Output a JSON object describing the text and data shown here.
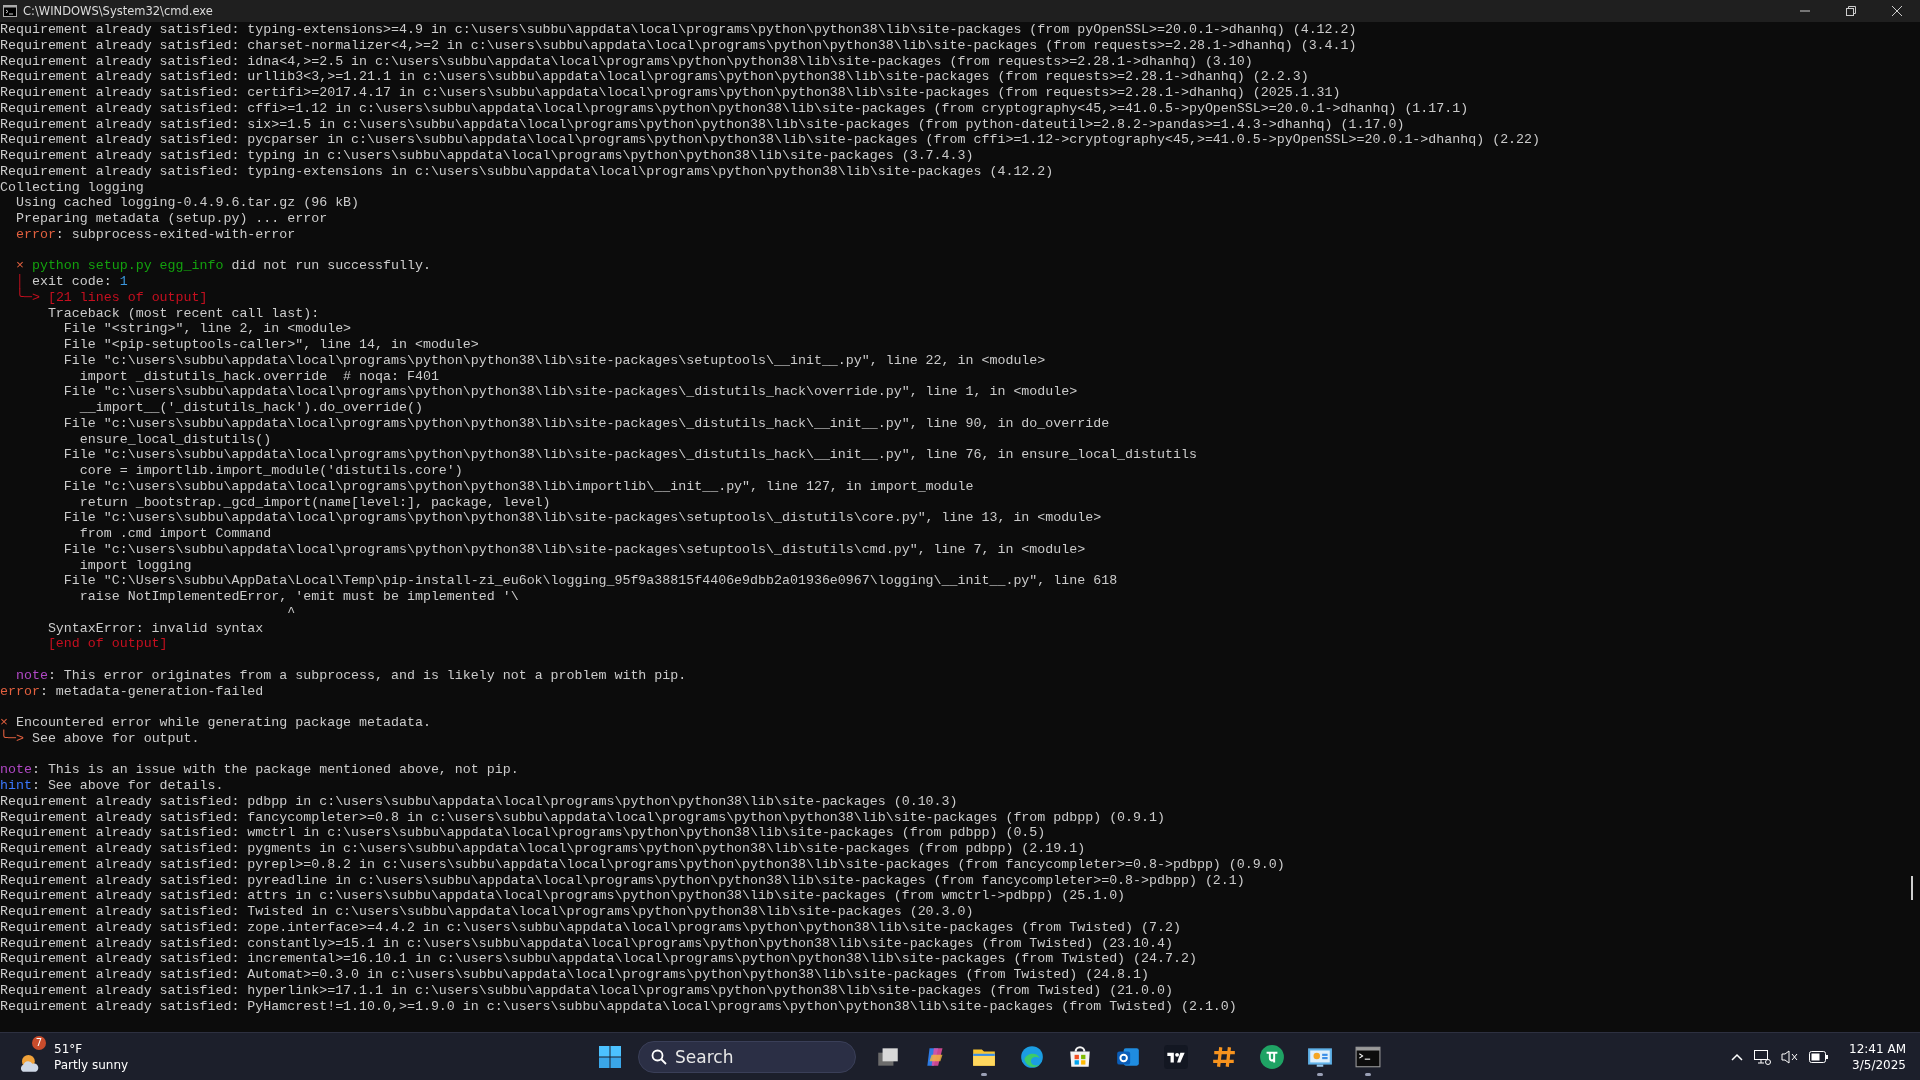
{
  "window": {
    "title": "C:\\WINDOWS\\System32\\cmd.exe"
  },
  "terminal": {
    "lines": [
      {
        "kind": "output",
        "spans": [
          {
            "text": "Requirement already satisfied: typing-extensions>=4.9 in c:\\users\\subbu\\appdata\\local\\programs\\python\\python38\\lib\\site-packages (from pyOpenSSL>=20.0.1->dhanhq) (4.12.2)",
            "kind": "plain"
          }
        ]
      },
      {
        "kind": "output",
        "spans": [
          {
            "text": "Requirement already satisfied: charset-normalizer<4,>=2 in c:\\users\\subbu\\appdata\\local\\programs\\python\\python38\\lib\\site-packages (from requests>=2.28.1->dhanhq) (3.4.1)",
            "kind": "plain"
          }
        ]
      },
      {
        "kind": "output",
        "spans": [
          {
            "text": "Requirement already satisfied: idna<4,>=2.5 in c:\\users\\subbu\\appdata\\local\\programs\\python\\python38\\lib\\site-packages (from requests>=2.28.1->dhanhq) (3.10)",
            "kind": "plain"
          }
        ]
      },
      {
        "kind": "output",
        "spans": [
          {
            "text": "Requirement already satisfied: urllib3<3,>=1.21.1 in c:\\users\\subbu\\appdata\\local\\programs\\python\\python38\\lib\\site-packages (from requests>=2.28.1->dhanhq) (2.2.3)",
            "kind": "plain"
          }
        ]
      },
      {
        "kind": "output",
        "spans": [
          {
            "text": "Requirement already satisfied: certifi>=2017.4.17 in c:\\users\\subbu\\appdata\\local\\programs\\python\\python38\\lib\\site-packages (from requests>=2.28.1->dhanhq) (2025.1.31)",
            "kind": "plain"
          }
        ]
      },
      {
        "kind": "output",
        "spans": [
          {
            "text": "Requirement already satisfied: cffi>=1.12 in c:\\users\\subbu\\appdata\\local\\programs\\python\\python38\\lib\\site-packages (from cryptography<45,>=41.0.5->pyOpenSSL>=20.0.1->dhanhq) (1.17.1)",
            "kind": "plain"
          }
        ]
      },
      {
        "kind": "output",
        "spans": [
          {
            "text": "Requirement already satisfied: six>=1.5 in c:\\users\\subbu\\appdata\\local\\programs\\python\\python38\\lib\\site-packages (from python-dateutil>=2.8.2->pandas>=1.4.3->dhanhq) (1.17.0)",
            "kind": "plain"
          }
        ]
      },
      {
        "kind": "output",
        "spans": [
          {
            "text": "Requirement already satisfied: pycparser in c:\\users\\subbu\\appdata\\local\\programs\\python\\python38\\lib\\site-packages (from cffi>=1.12->cryptography<45,>=41.0.5->pyOpenSSL>=20.0.1->dhanhq) (2.22)",
            "kind": "plain"
          }
        ]
      },
      {
        "kind": "output",
        "spans": [
          {
            "text": "Requirement already satisfied: typing in c:\\users\\subbu\\appdata\\local\\programs\\python\\python38\\lib\\site-packages (3.7.4.3)",
            "kind": "plain"
          }
        ]
      },
      {
        "kind": "output",
        "spans": [
          {
            "text": "Requirement already satisfied: typing-extensions in c:\\users\\subbu\\appdata\\local\\programs\\python\\python38\\lib\\site-packages (4.12.2)",
            "kind": "plain"
          }
        ]
      },
      {
        "kind": "output",
        "spans": [
          {
            "text": "Collecting logging",
            "kind": "plain"
          }
        ]
      },
      {
        "kind": "output",
        "spans": [
          {
            "text": "  Using cached logging-0.4.9.6.tar.gz (96 kB)",
            "kind": "plain"
          }
        ]
      },
      {
        "kind": "output",
        "spans": [
          {
            "text": "  Preparing metadata (setup.py) ... error",
            "kind": "plain"
          }
        ]
      },
      {
        "kind": "output",
        "spans": [
          {
            "text": "  error",
            "kind": "error"
          },
          {
            "text": ": subprocess-exited-with-error",
            "kind": "plain"
          }
        ]
      },
      {
        "kind": "blank"
      },
      {
        "kind": "output",
        "spans": [
          {
            "text": "  ×",
            "kind": "error"
          },
          {
            "text": " python setup.py egg_info",
            "kind": "green"
          },
          {
            "text": " did not run successfully.",
            "kind": "plain"
          }
        ]
      },
      {
        "kind": "output",
        "spans": [
          {
            "text": "  │",
            "kind": "red"
          },
          {
            "text": " exit code: ",
            "kind": "plain"
          },
          {
            "text": "1",
            "kind": "cyan"
          }
        ]
      },
      {
        "kind": "output",
        "spans": [
          {
            "text": "  ╰─> [21 lines of output]",
            "kind": "red"
          }
        ]
      },
      {
        "kind": "output",
        "spans": [
          {
            "text": "      Traceback (most recent call last):",
            "kind": "plain"
          }
        ]
      },
      {
        "kind": "output",
        "spans": [
          {
            "text": "        File \"<string>\", line 2, in <module>",
            "kind": "plain"
          }
        ]
      },
      {
        "kind": "output",
        "spans": [
          {
            "text": "        File \"<pip-setuptools-caller>\", line 14, in <module>",
            "kind": "plain"
          }
        ]
      },
      {
        "kind": "output",
        "spans": [
          {
            "text": "        File \"c:\\users\\subbu\\appdata\\local\\programs\\python\\python38\\lib\\site-packages\\setuptools\\__init__.py\", line 22, in <module>",
            "kind": "plain"
          }
        ]
      },
      {
        "kind": "output",
        "spans": [
          {
            "text": "          import _distutils_hack.override  # noqa: F401",
            "kind": "plain"
          }
        ]
      },
      {
        "kind": "output",
        "spans": [
          {
            "text": "        File \"c:\\users\\subbu\\appdata\\local\\programs\\python\\python38\\lib\\site-packages\\_distutils_hack\\override.py\", line 1, in <module>",
            "kind": "plain"
          }
        ]
      },
      {
        "kind": "output",
        "spans": [
          {
            "text": "          __import__('_distutils_hack').do_override()",
            "kind": "plain"
          }
        ]
      },
      {
        "kind": "output",
        "spans": [
          {
            "text": "        File \"c:\\users\\subbu\\appdata\\local\\programs\\python\\python38\\lib\\site-packages\\_distutils_hack\\__init__.py\", line 90, in do_override",
            "kind": "plain"
          }
        ]
      },
      {
        "kind": "output",
        "spans": [
          {
            "text": "          ensure_local_distutils()",
            "kind": "plain"
          }
        ]
      },
      {
        "kind": "output",
        "spans": [
          {
            "text": "        File \"c:\\users\\subbu\\appdata\\local\\programs\\python\\python38\\lib\\site-packages\\_distutils_hack\\__init__.py\", line 76, in ensure_local_distutils",
            "kind": "plain"
          }
        ]
      },
      {
        "kind": "output",
        "spans": [
          {
            "text": "          core = importlib.import_module('distutils.core')",
            "kind": "plain"
          }
        ]
      },
      {
        "kind": "output",
        "spans": [
          {
            "text": "        File \"c:\\users\\subbu\\appdata\\local\\programs\\python\\python38\\lib\\importlib\\__init__.py\", line 127, in import_module",
            "kind": "plain"
          }
        ]
      },
      {
        "kind": "output",
        "spans": [
          {
            "text": "          return _bootstrap._gcd_import(name[level:], package, level)",
            "kind": "plain"
          }
        ]
      },
      {
        "kind": "output",
        "spans": [
          {
            "text": "        File \"c:\\users\\subbu\\appdata\\local\\programs\\python\\python38\\lib\\site-packages\\setuptools\\_distutils\\core.py\", line 13, in <module>",
            "kind": "plain"
          }
        ]
      },
      {
        "kind": "output",
        "spans": [
          {
            "text": "          from .cmd import Command",
            "kind": "plain"
          }
        ]
      },
      {
        "kind": "output",
        "spans": [
          {
            "text": "        File \"c:\\users\\subbu\\appdata\\local\\programs\\python\\python38\\lib\\site-packages\\setuptools\\_distutils\\cmd.py\", line 7, in <module>",
            "kind": "plain"
          }
        ]
      },
      {
        "kind": "output",
        "spans": [
          {
            "text": "          import logging",
            "kind": "plain"
          }
        ]
      },
      {
        "kind": "output",
        "spans": [
          {
            "text": "        File \"C:\\Users\\subbu\\AppData\\Local\\Temp\\pip-install-zi_eu6ok\\logging_95f9a38815f4406e9dbb2a01936e0967\\logging\\__init__.py\", line 618",
            "kind": "plain"
          }
        ]
      },
      {
        "kind": "output",
        "spans": [
          {
            "text": "          raise NotImplementedError, 'emit must be implemented '\\",
            "kind": "plain"
          }
        ]
      },
      {
        "kind": "output",
        "spans": [
          {
            "text": "                                    ^",
            "kind": "plain"
          }
        ]
      },
      {
        "kind": "output",
        "spans": [
          {
            "text": "      SyntaxError: invalid syntax",
            "kind": "plain"
          }
        ]
      },
      {
        "kind": "output",
        "spans": [
          {
            "text": "      [end of output]",
            "kind": "red"
          }
        ]
      },
      {
        "kind": "blank"
      },
      {
        "kind": "output",
        "spans": [
          {
            "text": "  note",
            "kind": "note"
          },
          {
            "text": ": This error originates from a subprocess, and is likely not a problem with pip.",
            "kind": "plain"
          }
        ]
      },
      {
        "kind": "output",
        "spans": [
          {
            "text": "error",
            "kind": "error"
          },
          {
            "text": ": metadata-generation-failed",
            "kind": "plain"
          }
        ]
      },
      {
        "kind": "blank"
      },
      {
        "kind": "output",
        "spans": [
          {
            "text": "×",
            "kind": "error"
          },
          {
            "text": " Encountered error while generating package metadata.",
            "kind": "plain"
          }
        ]
      },
      {
        "kind": "output",
        "spans": [
          {
            "text": "╰─>",
            "kind": "error"
          },
          {
            "text": " See above for output.",
            "kind": "plain"
          }
        ]
      },
      {
        "kind": "blank"
      },
      {
        "kind": "output",
        "spans": [
          {
            "text": "note",
            "kind": "note"
          },
          {
            "text": ": This is an issue with the package mentioned above, not pip.",
            "kind": "plain"
          }
        ]
      },
      {
        "kind": "output",
        "spans": [
          {
            "text": "hint",
            "kind": "hint"
          },
          {
            "text": ": See above for details.",
            "kind": "plain"
          }
        ]
      },
      {
        "kind": "output",
        "spans": [
          {
            "text": "Requirement already satisfied: pdbpp in c:\\users\\subbu\\appdata\\local\\programs\\python\\python38\\lib\\site-packages (0.10.3)",
            "kind": "plain"
          }
        ]
      },
      {
        "kind": "output",
        "spans": [
          {
            "text": "Requirement already satisfied: fancycompleter>=0.8 in c:\\users\\subbu\\appdata\\local\\programs\\python\\python38\\lib\\site-packages (from pdbpp) (0.9.1)",
            "kind": "plain"
          }
        ]
      },
      {
        "kind": "output",
        "spans": [
          {
            "text": "Requirement already satisfied: wmctrl in c:\\users\\subbu\\appdata\\local\\programs\\python\\python38\\lib\\site-packages (from pdbpp) (0.5)",
            "kind": "plain"
          }
        ]
      },
      {
        "kind": "output",
        "spans": [
          {
            "text": "Requirement already satisfied: pygments in c:\\users\\subbu\\appdata\\local\\programs\\python\\python38\\lib\\site-packages (from pdbpp) (2.19.1)",
            "kind": "plain"
          }
        ]
      },
      {
        "kind": "output",
        "spans": [
          {
            "text": "Requirement already satisfied: pyrepl>=0.8.2 in c:\\users\\subbu\\appdata\\local\\programs\\python\\python38\\lib\\site-packages (from fancycompleter>=0.8->pdbpp) (0.9.0)",
            "kind": "plain"
          }
        ]
      },
      {
        "kind": "output",
        "spans": [
          {
            "text": "Requirement already satisfied: pyreadline in c:\\users\\subbu\\appdata\\local\\programs\\python\\python38\\lib\\site-packages (from fancycompleter>=0.8->pdbpp) (2.1)",
            "kind": "plain"
          }
        ]
      },
      {
        "kind": "output",
        "spans": [
          {
            "text": "Requirement already satisfied: attrs in c:\\users\\subbu\\appdata\\local\\programs\\python\\python38\\lib\\site-packages (from wmctrl->pdbpp) (25.1.0)",
            "kind": "plain"
          }
        ]
      },
      {
        "kind": "output",
        "spans": [
          {
            "text": "Requirement already satisfied: Twisted in c:\\users\\subbu\\appdata\\local\\programs\\python\\python38\\lib\\site-packages (20.3.0)",
            "kind": "plain"
          }
        ]
      },
      {
        "kind": "output",
        "spans": [
          {
            "text": "Requirement already satisfied: zope.interface>=4.4.2 in c:\\users\\subbu\\appdata\\local\\programs\\python\\python38\\lib\\site-packages (from Twisted) (7.2)",
            "kind": "plain"
          }
        ]
      },
      {
        "kind": "output",
        "spans": [
          {
            "text": "Requirement already satisfied: constantly>=15.1 in c:\\users\\subbu\\appdata\\local\\programs\\python\\python38\\lib\\site-packages (from Twisted) (23.10.4)",
            "kind": "plain"
          }
        ]
      },
      {
        "kind": "output",
        "spans": [
          {
            "text": "Requirement already satisfied: incremental>=16.10.1 in c:\\users\\subbu\\appdata\\local\\programs\\python\\python38\\lib\\site-packages (from Twisted) (24.7.2)",
            "kind": "plain"
          }
        ]
      },
      {
        "kind": "output",
        "spans": [
          {
            "text": "Requirement already satisfied: Automat>=0.3.0 in c:\\users\\subbu\\appdata\\local\\programs\\python\\python38\\lib\\site-packages (from Twisted) (24.8.1)",
            "kind": "plain"
          }
        ]
      },
      {
        "kind": "output",
        "spans": [
          {
            "text": "Requirement already satisfied: hyperlink>=17.1.1 in c:\\users\\subbu\\appdata\\local\\programs\\python\\python38\\lib\\site-packages (from Twisted) (21.0.0)",
            "kind": "plain"
          }
        ]
      },
      {
        "kind": "output",
        "spans": [
          {
            "text": "Requirement already satisfied: PyHamcrest!=1.10.0,>=1.9.0 in c:\\users\\subbu\\appdata\\local\\programs\\python\\python38\\lib\\site-packages (from Twisted) (2.1.0)",
            "kind": "plain"
          }
        ]
      }
    ]
  },
  "taskbar": {
    "weather": {
      "badge": "7",
      "temperature": "51°F",
      "condition": "Partly sunny"
    },
    "search": {
      "placeholder": "Search"
    },
    "apps": [
      {
        "kind": "task-view",
        "running": false
      },
      {
        "kind": "copilot",
        "running": false
      },
      {
        "kind": "explorer",
        "running": true
      },
      {
        "kind": "edge",
        "running": false
      },
      {
        "kind": "store",
        "running": false
      },
      {
        "kind": "outlook",
        "running": false
      },
      {
        "kind": "tv",
        "running": false
      },
      {
        "kind": "hash",
        "running": false
      },
      {
        "kind": "green-circle",
        "running": false
      },
      {
        "kind": "monitor",
        "running": true
      },
      {
        "kind": "terminal",
        "running": true
      }
    ],
    "clock": {
      "time": "12:41 AM",
      "date": "3/5/2025"
    }
  }
}
